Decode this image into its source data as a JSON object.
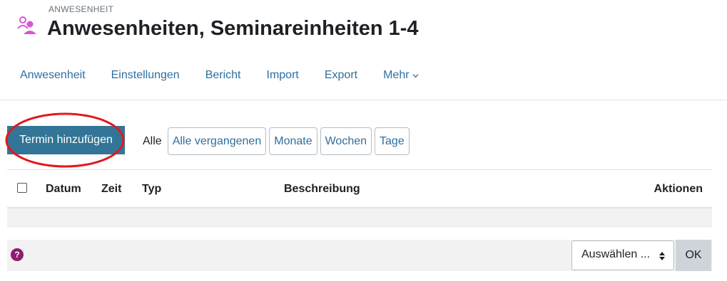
{
  "header": {
    "pretitle": "ANWESENHEIT",
    "title": "Anwesenheiten, Seminareinheiten 1-4",
    "icon": "attendance-people-icon",
    "icon_color": "#d856d6"
  },
  "nav": {
    "items": [
      "Anwesenheit",
      "Einstellungen",
      "Bericht",
      "Import",
      "Export",
      "Mehr"
    ]
  },
  "actions": {
    "add_button": "Termin hinzufügen",
    "accent_color": "#327596",
    "highlight_color": "#e3181d"
  },
  "filters": {
    "current": "Alle",
    "options": [
      "Alle vergangenen",
      "Monate",
      "Wochen",
      "Tage"
    ]
  },
  "table": {
    "columns": [
      "Datum",
      "Zeit",
      "Typ",
      "Beschreibung",
      "Aktionen"
    ],
    "rows": []
  },
  "footer": {
    "help_icon": "question-circle-icon",
    "select_value": "Auswählen ...",
    "ok_label": "OK"
  }
}
